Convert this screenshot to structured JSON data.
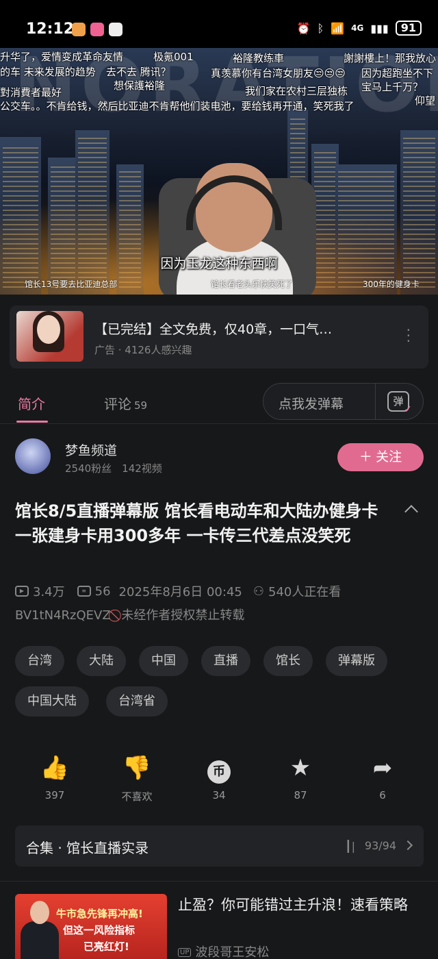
{
  "status_bar": {
    "time": "12:12",
    "network": "4G",
    "battery": "91"
  },
  "video": {
    "watermark": "NORATIONS",
    "subtitle": "因为玉龙这种东西啊",
    "danmaku": [
      "升华了，爱情变成革命友情",
      "极氪001",
      "裕隆教练車",
      "謝謝樓上！那我放心",
      "的车 未来发展的趋势",
      "去不去 腾讯？",
      "真羡慕你有台湾女朋友😒😒😒",
      "因为超跑坐不下",
      "想保護裕隆",
      "宝马上千万？",
      "對消費者最好",
      "我们家在农村三层独栋",
      "仰望",
      "公交车。。不肯给钱，然后比亚迪不肯帮他们装电池，要给钱再开通，笑死我了"
    ],
    "chapters": [
      "馆长13号要去比亚迪总部",
      "馆长看老头乐快笑死了",
      "300年的健身卡"
    ]
  },
  "ad": {
    "title": "【已完结】全文免费，仅40章，一口气…",
    "sub": "广告 · 4126人感兴趣"
  },
  "tabs": {
    "intro": "简介",
    "comments": "评论",
    "comment_count": "59",
    "danmaku_placeholder": "点我发弹幕",
    "danmaku_icon": "弹"
  },
  "uploader": {
    "name": "梦鱼频道",
    "stats": "2540粉丝　142视频",
    "follow": "＋ 关注"
  },
  "video_info": {
    "title": "馆长8/5直播弹幕版 馆长看电动车和大陆办健身卡 一张建身卡用300多年 一卡传三代差点没笑死",
    "plays": "3.4万",
    "danmaku_count": "56",
    "date": "2025年8月6日 00:45",
    "watching": "540人正在看",
    "bvid": "BV1tN4RzQEVZ",
    "copyright": "未经作者授权禁止转载"
  },
  "tags": [
    "台湾",
    "大陆",
    "中国",
    "直播",
    "馆长",
    "弹幕版",
    "中国大陆",
    "台湾省"
  ],
  "actions": {
    "like": "397",
    "dislike": "不喜欢",
    "coin": "34",
    "favorite": "87",
    "share": "6"
  },
  "collection": {
    "title": "合集 · 馆长直播实录",
    "progress": "93/94"
  },
  "recommend": {
    "title": "止盈？你可能错过主升浪！速看策略",
    "author": "波段哥王安松",
    "up_badge": "UP",
    "thumb_line1": "牛市急先锋再冲高!",
    "thumb_line2": "但这一风险指标",
    "thumb_line3": "已亮红灯!"
  }
}
